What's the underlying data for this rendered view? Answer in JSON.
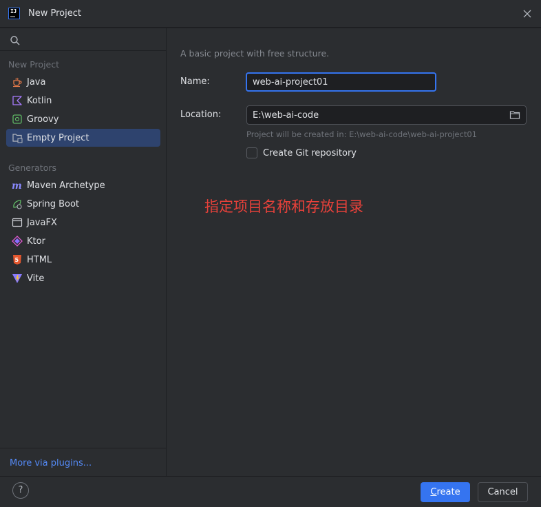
{
  "window": {
    "title": "New Project",
    "app_icon": "intellij-idea-icon",
    "app_icon_text": "IJ"
  },
  "sidebar": {
    "sections": [
      {
        "label": "New Project",
        "items": [
          {
            "label": "Java",
            "icon": "java-icon",
            "selected": false
          },
          {
            "label": "Kotlin",
            "icon": "kotlin-icon",
            "selected": false
          },
          {
            "label": "Groovy",
            "icon": "groovy-icon",
            "selected": false
          },
          {
            "label": "Empty Project",
            "icon": "empty-project-icon",
            "selected": true
          }
        ]
      },
      {
        "label": "Generators",
        "items": [
          {
            "label": "Maven Archetype",
            "icon": "maven-icon",
            "selected": false
          },
          {
            "label": "Spring Boot",
            "icon": "spring-boot-icon",
            "selected": false
          },
          {
            "label": "JavaFX",
            "icon": "javafx-icon",
            "selected": false
          },
          {
            "label": "Ktor",
            "icon": "ktor-icon",
            "selected": false
          },
          {
            "label": "HTML",
            "icon": "html5-icon",
            "selected": false
          },
          {
            "label": "Vite",
            "icon": "vite-icon",
            "selected": false
          }
        ]
      }
    ],
    "more_plugins": "More via plugins..."
  },
  "main": {
    "description": "A basic project with free structure.",
    "name_label": "Name:",
    "name_value": "web-ai-project01",
    "location_label": "Location:",
    "location_value": "E:\\web-ai-code",
    "hint": "Project will be created in: E:\\web-ai-code\\web-ai-project01",
    "git_label": "Create Git repository",
    "git_checked": false,
    "annotation": "指定项目名称和存放目录"
  },
  "footer": {
    "help": "?",
    "create_label_mnemonic": "C",
    "create_label_rest": "reate",
    "cancel_label": "Cancel"
  },
  "colors": {
    "accent": "#3574f0",
    "selection": "#2e436e",
    "annotation": "#e8413a",
    "link": "#548af7"
  }
}
